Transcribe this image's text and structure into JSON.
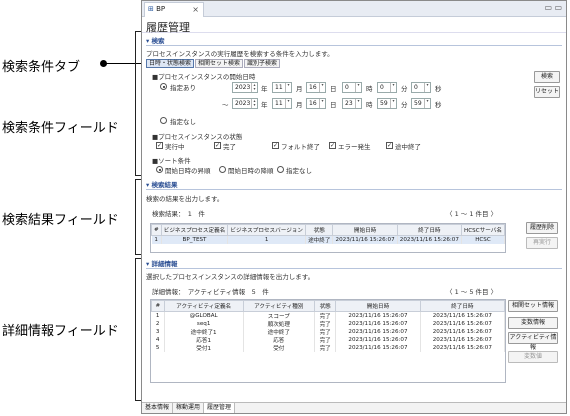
{
  "annotations": {
    "tab": "検索条件タブ",
    "fields": "検索条件フィールド",
    "results": "検索結果フィールド",
    "details": "詳細情報フィールド"
  },
  "window": {
    "tab_label": "BP",
    "close": "×",
    "min": "▭",
    "max": "▭",
    "page_title": "履歴管理"
  },
  "search": {
    "header": "検索",
    "desc": "プロセスインスタンスの実行履歴を検索する条件を入力します。",
    "tabs": [
      "日時・状態検索",
      "相関セット検索",
      "識別子検索"
    ],
    "start_label": "■プロセスインスタンスの開始日時",
    "spec_yes": "指定あり",
    "spec_no": "指定なし",
    "from": {
      "year": "2023",
      "month": "11",
      "day": "16",
      "hour": "0",
      "min": "0",
      "sec": "0"
    },
    "to": {
      "prefix": "〜",
      "year": "2023",
      "month": "11",
      "day": "16",
      "hour": "23",
      "min": "59",
      "sec": "59"
    },
    "units": {
      "y": "年",
      "m": "月",
      "d": "日",
      "h": "時",
      "mi": "分",
      "s": "秒"
    },
    "state_label": "■プロセスインスタンスの状態",
    "states": [
      "実行中",
      "完了",
      "フォルト終了",
      "エラー発生",
      "途中終了"
    ],
    "sort_label": "■ソート条件",
    "sorts": [
      "開始日時の昇順",
      "開始日時の降順",
      "指定なし"
    ],
    "search_btn": "検索",
    "reset_btn": "リセット"
  },
  "results": {
    "header": "検索結果",
    "desc": "検索の結果を出力します。",
    "count_label": "検索結果：",
    "count": "1",
    "unit": "件",
    "pager": "1 〜 1 件目",
    "columns": [
      "#",
      "ビジネスプロセス定義名",
      "ビジネスプロセスバージョン",
      "状態",
      "開始日時",
      "終了日時",
      "HCSCサーバ名"
    ],
    "rows": [
      [
        "1",
        "BP_TEST",
        "1",
        "途中終了",
        "2023/11/16 15:26:07",
        "2023/11/16 15:26:07",
        "HCSC"
      ]
    ],
    "delete_btn": "履歴削除",
    "rerun_btn": "再実行"
  },
  "details": {
    "header": "詳細情報",
    "desc": "選択したプロセスインスタンスの詳細情報を出力します。",
    "count_label": "詳細情報：　アクティビティ情報",
    "count": "5",
    "unit": "件",
    "pager": "1 〜 5 件目",
    "columns": [
      "#",
      "アクティビティ定義名",
      "アクティビティ種別",
      "状態",
      "開始日時",
      "終了日時"
    ],
    "rows": [
      [
        "1",
        "@GLOBAL",
        "スコープ",
        "完了",
        "2023/11/16 15:26:07",
        "2023/11/16 15:26:07"
      ],
      [
        "2",
        "seq1",
        "順次処理",
        "完了",
        "2023/11/16 15:26:07",
        "2023/11/16 15:26:07"
      ],
      [
        "3",
        "途中終了1",
        "途中終了",
        "完了",
        "2023/11/16 15:26:07",
        "2023/11/16 15:26:07"
      ],
      [
        "4",
        "応答1",
        "応答",
        "完了",
        "2023/11/16 15:26:07",
        "2023/11/16 15:26:07"
      ],
      [
        "5",
        "受付1",
        "受付",
        "完了",
        "2023/11/16 15:26:07",
        "2023/11/16 15:26:07"
      ]
    ],
    "buttons": [
      "相関セット情報",
      "変数情報",
      "アクティビティ情報",
      "変数値"
    ]
  },
  "bottom_tabs": [
    "基本情報",
    "稼動運用",
    "履歴管理"
  ]
}
